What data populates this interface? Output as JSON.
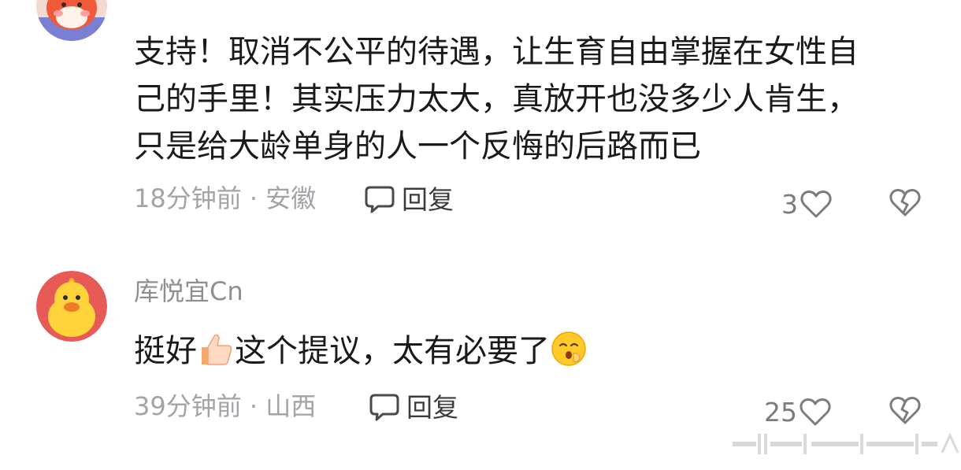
{
  "comments": [
    {
      "username": "",
      "content_lines": [
        "支持！取消不公平的待遇，让生育自由掌握在女性自",
        "己的手里！其实压力太大，真放开也没多少人肯生，",
        "只是给大龄单身的人一个反悔的后路而已"
      ],
      "meta": "18分钟前 · 安徽",
      "reply_label": "回复",
      "like_count": "3",
      "avatar_icon": "fox-avatar-icon"
    },
    {
      "username": "库悦宜Cn",
      "content_before_emoji": "挺好",
      "content_after_emoji": "这个提议，太有必要了",
      "meta": "39分钟前 · 山西",
      "reply_label": "回复",
      "like_count": "25",
      "avatar_icon": "yellow-duck-avatar-icon"
    }
  ],
  "colors": {
    "text_primary": "#1a1a1a",
    "text_secondary": "#8e8e93",
    "meta_gray": "#a3a3a8"
  }
}
